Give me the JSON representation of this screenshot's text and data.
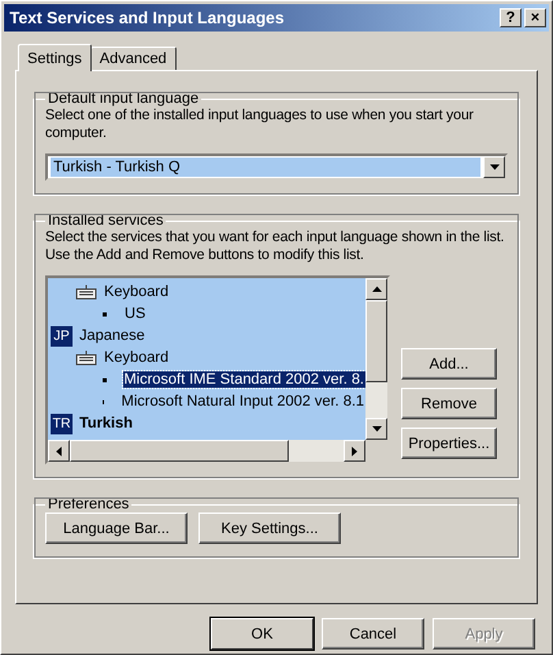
{
  "window": {
    "title": "Text Services and Input Languages",
    "title_buttons": [
      "?",
      "×"
    ]
  },
  "tabs": [
    {
      "label": "Settings",
      "selected": true
    },
    {
      "label": "Advanced",
      "selected": false
    }
  ],
  "default_language": {
    "legend": "Default input language",
    "description": "Select one of the installed input languages to use when you start your computer.",
    "value": "Turkish - Turkish Q"
  },
  "installed_services": {
    "legend": "Installed services",
    "description": "Select the services that you want for each input language shown in the list. Use the Add and Remove buttons to modify this list.",
    "tree": [
      {
        "kind": "category",
        "label": "Keyboard",
        "selected": false,
        "children": [
          {
            "kind": "service",
            "label": "US",
            "selected": false
          }
        ]
      },
      {
        "kind": "language",
        "badge": "JP",
        "label": "Japanese",
        "default": false,
        "selected": false,
        "children": [
          {
            "kind": "category",
            "label": "Keyboard",
            "selected": false,
            "children": [
              {
                "kind": "service",
                "label": "Microsoft IME Standard 2002 ver. 8.",
                "selected": true
              },
              {
                "kind": "service",
                "label": "Microsoft Natural Input 2002 ver. 8.1",
                "selected": false
              }
            ]
          }
        ]
      },
      {
        "kind": "language",
        "badge": "TR",
        "label": "Turkish",
        "default": true,
        "selected": false
      }
    ],
    "buttons": [
      {
        "label": "Add..."
      },
      {
        "label": "Remove"
      },
      {
        "label": "Properties..."
      }
    ]
  },
  "preferences": {
    "legend": "Preferences",
    "buttons": [
      {
        "label": "Language Bar..."
      },
      {
        "label": "Key Settings..."
      }
    ]
  },
  "footer_buttons": [
    {
      "label": "OK",
      "default": true,
      "disabled": false
    },
    {
      "label": "Cancel",
      "default": false,
      "disabled": false
    },
    {
      "label": "Apply",
      "default": false,
      "disabled": true
    }
  ]
}
